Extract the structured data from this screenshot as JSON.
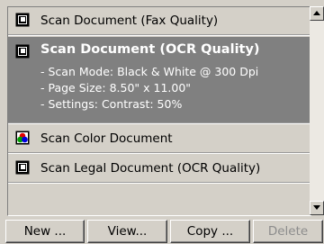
{
  "scan_list": {
    "items": [
      {
        "label": "Scan Document (Fax Quality)",
        "icon": "bw-scan-icon"
      },
      {
        "label": "Scan Document (OCR Quality)",
        "icon": "bw-scan-icon",
        "selected": true,
        "details": [
          "- Scan Mode: Black & White @ 300 Dpi",
          "- Page Size:  8.50\" x 11.00\"",
          "- Settings: Contrast: 50%"
        ]
      },
      {
        "label": "Scan Color Document",
        "icon": "color-scan-icon"
      },
      {
        "label": "Scan Legal Document (OCR Quality)",
        "icon": "bw-scan-icon"
      }
    ]
  },
  "buttons": {
    "new_label": "New ...",
    "view_label": "View...",
    "copy_label": "Copy ...",
    "delete_label": "Delete"
  },
  "colors": {
    "selection_bg": "#808080",
    "window_bg": "#d4d0c8"
  }
}
